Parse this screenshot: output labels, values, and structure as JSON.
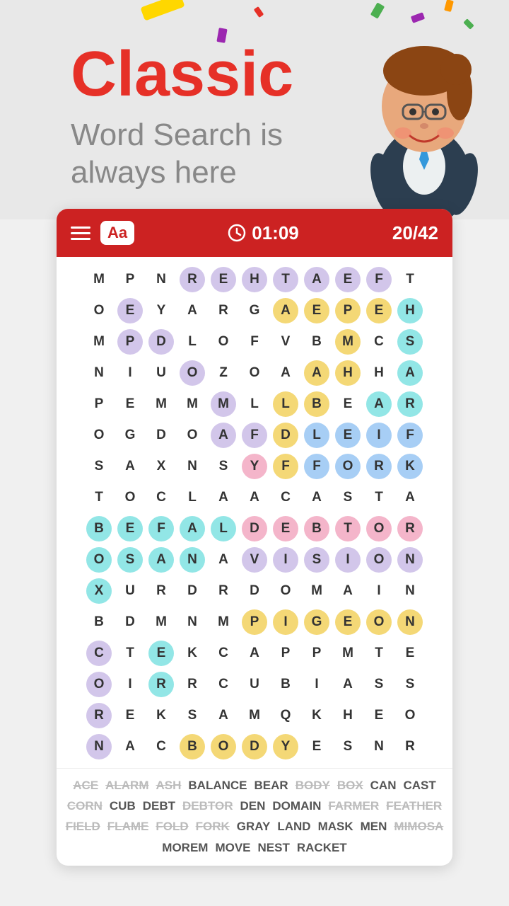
{
  "header": {
    "title": "Classic",
    "subtitle_line1": "Word Search is",
    "subtitle_line2": "always here"
  },
  "toolbar": {
    "menu_label": "menu",
    "font_label": "Aa",
    "timer": "01:09",
    "score": "20/42"
  },
  "grid": {
    "rows": [
      [
        "M",
        "P",
        "N",
        "R",
        "E",
        "H",
        "T",
        "A",
        "E",
        "F",
        "T"
      ],
      [
        "O",
        "E",
        "Y",
        "A",
        "R",
        "G",
        "A",
        "E",
        "P",
        "E",
        "H"
      ],
      [
        "M",
        "P",
        "D",
        "L",
        "O",
        "F",
        "V",
        "B",
        "M",
        "C",
        "S"
      ],
      [
        "N",
        "I",
        "U",
        "O",
        "Z",
        "O",
        "A",
        "A",
        "H",
        "H",
        "A"
      ],
      [
        "P",
        "E",
        "M",
        "M",
        "M",
        "L",
        "L",
        "B",
        "E",
        "A",
        "R"
      ],
      [
        "O",
        "G",
        "D",
        "O",
        "A",
        "F",
        "D",
        "L",
        "E",
        "I",
        "F"
      ],
      [
        "S",
        "A",
        "X",
        "N",
        "S",
        "Y",
        "F",
        "F",
        "O",
        "R",
        "K"
      ],
      [
        "T",
        "O",
        "C",
        "L",
        "A",
        "A",
        "C",
        "A",
        "S",
        "T",
        "A"
      ],
      [
        "B",
        "E",
        "F",
        "A",
        "L",
        "D",
        "E",
        "B",
        "T",
        "O",
        "R"
      ],
      [
        "O",
        "S",
        "A",
        "N",
        "A",
        "V",
        "I",
        "S",
        "I",
        "O",
        "N"
      ],
      [
        "X",
        "U",
        "R",
        "D",
        "R",
        "D",
        "O",
        "M",
        "A",
        "I",
        "N"
      ],
      [
        "B",
        "D",
        "M",
        "N",
        "M",
        "P",
        "I",
        "G",
        "E",
        "O",
        "N"
      ],
      [
        "C",
        "T",
        "E",
        "K",
        "C",
        "A",
        "P",
        "P",
        "M",
        "T",
        "E"
      ],
      [
        "O",
        "I",
        "R",
        "R",
        "C",
        "U",
        "B",
        "I",
        "A",
        "S",
        "S"
      ],
      [
        "R",
        "E",
        "K",
        "S",
        "A",
        "M",
        "Q",
        "K",
        "H",
        "E",
        "O"
      ],
      [
        "N",
        "A",
        "C",
        "B",
        "O",
        "D",
        "Y",
        "E",
        "S",
        "N",
        "R"
      ]
    ]
  },
  "words": [
    {
      "word": "ACE",
      "found": true
    },
    {
      "word": "ALARM",
      "found": true
    },
    {
      "word": "ASH",
      "found": true
    },
    {
      "word": "BALANCE",
      "found": false
    },
    {
      "word": "BEAR",
      "found": false
    },
    {
      "word": "BODY",
      "found": true
    },
    {
      "word": "BOX",
      "found": true
    },
    {
      "word": "CAN",
      "found": false
    },
    {
      "word": "CAST",
      "found": false
    },
    {
      "word": "CORN",
      "found": true
    },
    {
      "word": "CUB",
      "found": false
    },
    {
      "word": "DEBT",
      "found": false
    },
    {
      "word": "DEBTOR",
      "found": true
    },
    {
      "word": "DEN",
      "found": false
    },
    {
      "word": "DOMAIN",
      "found": false
    },
    {
      "word": "FARMER",
      "found": true
    },
    {
      "word": "FEATHER",
      "found": true
    },
    {
      "word": "FIELD",
      "found": true
    },
    {
      "word": "FLAME",
      "found": true
    },
    {
      "word": "FOLD",
      "found": true
    },
    {
      "word": "FORK",
      "found": true
    },
    {
      "word": "GRAY",
      "found": false
    },
    {
      "word": "LAND",
      "found": false
    },
    {
      "word": "MASK",
      "found": false
    },
    {
      "word": "MEN",
      "found": false
    },
    {
      "word": "MIMOSA",
      "found": true
    },
    {
      "word": "MOREM",
      "found": false
    },
    {
      "word": "MOVE",
      "found": false
    },
    {
      "word": "NEST",
      "found": false
    },
    {
      "word": "RACKET",
      "found": false
    }
  ]
}
